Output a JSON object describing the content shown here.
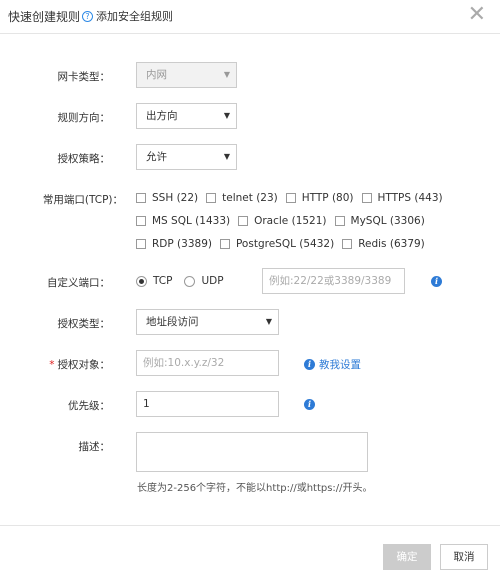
{
  "dialog": {
    "title": "快速创建规则",
    "help_link": "添加安全组规则",
    "close_glyph": "✕"
  },
  "form": {
    "nic_type": {
      "label": "网卡类型：",
      "value": "内网"
    },
    "direction": {
      "label": "规则方向：",
      "value": "出方向"
    },
    "policy": {
      "label": "授权策略：",
      "value": "允许"
    },
    "common_ports": {
      "label": "常用端口(TCP)：",
      "rows": [
        [
          "SSH (22)",
          "telnet (23)",
          "HTTP (80)",
          "HTTPS (443)"
        ],
        [
          "MS SQL (1433)",
          "Oracle (1521)",
          "MySQL (3306)"
        ],
        [
          "RDP (3389)",
          "PostgreSQL (5432)",
          "Redis (6379)"
        ]
      ]
    },
    "custom_port": {
      "label": "自定义端口：",
      "protocols": [
        "TCP",
        "UDP"
      ],
      "selected": "TCP",
      "placeholder": "例如:22/22或3389/3389"
    },
    "auth_type": {
      "label": "授权类型：",
      "value": "地址段访问"
    },
    "auth_object": {
      "label": "授权对象：",
      "required_mark": "*",
      "placeholder": "例如:10.x.y.z/32",
      "help_link": "教我设置"
    },
    "priority": {
      "label": "优先级：",
      "value": "1"
    },
    "description": {
      "label": "描述：",
      "hint": "长度为2-256个字符，不能以http://或https://开头。"
    }
  },
  "footer": {
    "confirm": "确定",
    "cancel": "取消"
  },
  "colors": {
    "accent": "#2e7bd6",
    "required": "#e02020",
    "disabled_button": "#cccccc"
  },
  "icons": {
    "help": "question-circle-icon",
    "info": "info-circle-icon",
    "close": "close-icon",
    "dropdown": "caret-down-icon"
  }
}
